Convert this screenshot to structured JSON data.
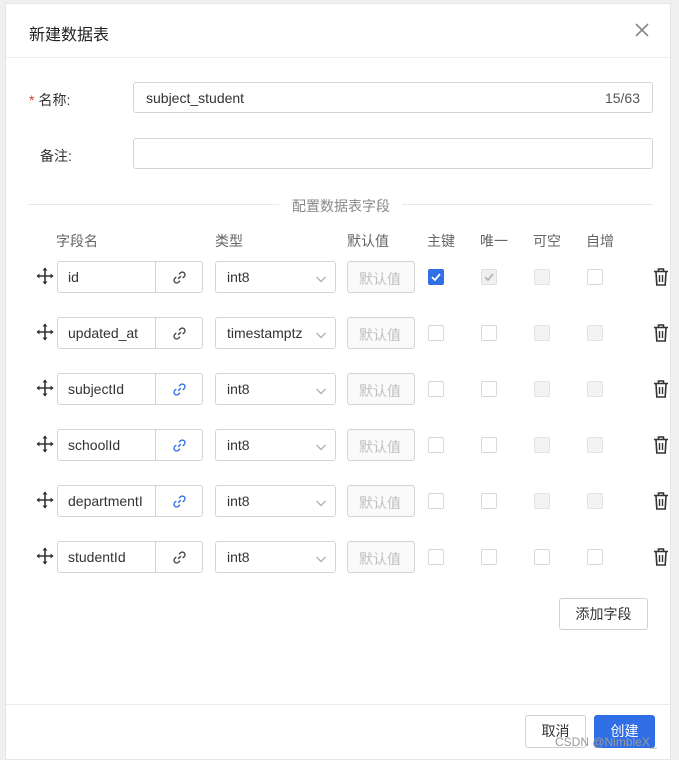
{
  "dialog": {
    "title": "新建数据表",
    "close_label": "×"
  },
  "form": {
    "name_label": "名称:",
    "required_mark": "*",
    "name_value": "subject_student",
    "name_count": "15/63",
    "note_label": "备注:",
    "note_value": ""
  },
  "section_title": "配置数据表字段",
  "columns": {
    "field_name": "字段名",
    "type": "类型",
    "default": "默认值",
    "primary": "主键",
    "unique": "唯一",
    "nullable": "可空",
    "auto_inc": "自增"
  },
  "default_placeholder": "默认值",
  "fields": [
    {
      "name": "id",
      "type": "int8",
      "link_active": false,
      "primary": "checked",
      "unique": "checked-disabled",
      "nullable": "disabled",
      "auto_inc": "unchecked"
    },
    {
      "name": "updated_at",
      "type": "timestamptz",
      "link_active": false,
      "primary": "unchecked",
      "unique": "unchecked",
      "nullable": "disabled",
      "auto_inc": "disabled"
    },
    {
      "name": "subjectId",
      "type": "int8",
      "link_active": true,
      "primary": "unchecked",
      "unique": "unchecked",
      "nullable": "disabled",
      "auto_inc": "disabled"
    },
    {
      "name": "schoolId",
      "type": "int8",
      "link_active": true,
      "primary": "unchecked",
      "unique": "unchecked",
      "nullable": "disabled",
      "auto_inc": "disabled"
    },
    {
      "name": "departmentI",
      "type": "int8",
      "link_active": true,
      "primary": "unchecked",
      "unique": "unchecked",
      "nullable": "disabled",
      "auto_inc": "disabled"
    },
    {
      "name": "studentId",
      "type": "int8",
      "link_active": false,
      "primary": "unchecked",
      "unique": "unchecked",
      "nullable": "unchecked",
      "auto_inc": "unchecked"
    }
  ],
  "add_field_label": "添加字段",
  "footer": {
    "cancel_label": "取消",
    "create_label": "创建"
  },
  "watermark": "CSDN @NimbleX_",
  "colors": {
    "accent": "#2f6ee5",
    "required": "#e0352b",
    "link_active": "#2f6ee5",
    "link_inactive": "#444444"
  }
}
